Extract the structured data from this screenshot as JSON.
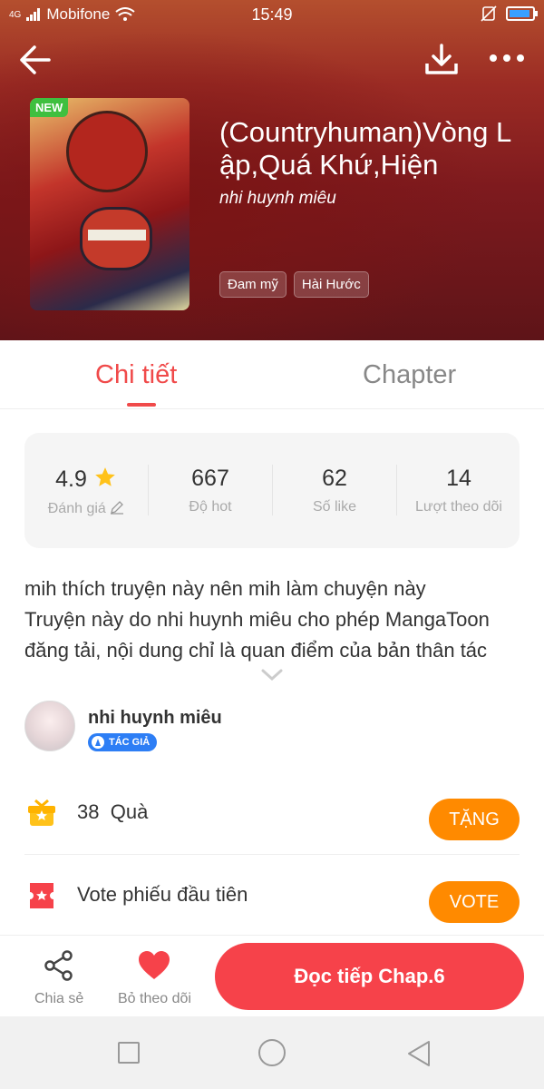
{
  "status": {
    "carrier": "Mobifone",
    "network": "4G",
    "time": "15:49",
    "battery_level": 0.9
  },
  "header": {
    "title": "(Countryhuman)Vòng Lập,Quá Khứ,Hiện",
    "author": "nhi huynh miêu",
    "cover_badge": "NEW",
    "tags": [
      "Đam mỹ",
      "Hài Hước"
    ]
  },
  "tabs": [
    {
      "label": "Chi tiết",
      "active": true
    },
    {
      "label": "Chapter",
      "active": false
    }
  ],
  "stats": [
    {
      "value": "4.9",
      "label": "Đánh giá"
    },
    {
      "value": "667",
      "label": "Độ hot"
    },
    {
      "value": "62",
      "label": "Số like"
    },
    {
      "value": "14",
      "label": "Lượt theo dõi"
    }
  ],
  "description": {
    "line1": "mih thích truyện này nên mih làm chuyện này",
    "line2": "Truyện này do nhi huynh miêu cho phép MangaToon",
    "line3": "đăng tải, nội dung chỉ là quan điểm của bản thân tác"
  },
  "author_card": {
    "name": "nhi huynh miêu",
    "role": "TÁC GIẢ"
  },
  "gift": {
    "count": "38",
    "label": "Quà",
    "button": "TẶNG"
  },
  "vote": {
    "label": "Vote phiếu đầu tiên",
    "button": "VOTE"
  },
  "bottom": {
    "share": "Chia sẻ",
    "unfollow": "Bỏ theo dõi",
    "read": "Đọc tiếp Chap.6"
  },
  "colors": {
    "accent": "#f04a4a",
    "read_button": "#f6424a",
    "orange": "#ff8a00",
    "badge_green": "#3fbf3f",
    "role_blue": "#2d7ef5"
  },
  "icons": [
    "back-arrow-icon",
    "download-icon",
    "more-icon",
    "star-icon",
    "edit-icon",
    "chevron-down-icon",
    "gift-icon",
    "ticket-icon",
    "share-icon",
    "heart-icon"
  ]
}
